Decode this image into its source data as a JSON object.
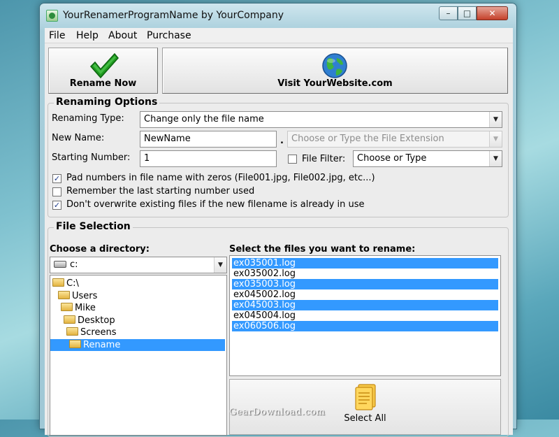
{
  "window": {
    "title": "YourRenamerProgramName by YourCompany",
    "controls": {
      "minimize": "–",
      "maximize": "□",
      "close": "✕"
    }
  },
  "menu": {
    "items": [
      "File",
      "Help",
      "About",
      "Purchase"
    ]
  },
  "toolbar": {
    "rename_now": "Rename Now",
    "visit_website": "Visit YourWebsite.com"
  },
  "renaming_options": {
    "title": "Renaming Options",
    "type_label": "Renaming Type:",
    "type_value": "Change only the file name",
    "new_name_label": "New Name:",
    "new_name_value": "NewName",
    "extension_placeholder": "Choose or Type the File Extension",
    "separator": ".",
    "starting_number_label": "Starting Number:",
    "starting_number_value": "1",
    "file_filter_label": "File Filter:",
    "file_filter_checked": false,
    "file_filter_value": "Choose or Type",
    "checkboxes": [
      {
        "label": "Pad numbers in file name with zeros (File001.jpg, File002.jpg, etc...)",
        "checked": true
      },
      {
        "label": "Remember the last starting number used",
        "checked": false
      },
      {
        "label": "Don't overwrite existing files if the new filename is already in use",
        "checked": true
      }
    ]
  },
  "file_selection": {
    "title": "File Selection",
    "directory_label": "Choose a directory:",
    "drive_value": "c:",
    "tree": [
      {
        "label": "C:\\",
        "depth": 0,
        "selected": false
      },
      {
        "label": "Users",
        "depth": 1,
        "selected": false
      },
      {
        "label": "Mike",
        "depth": 2,
        "selected": false
      },
      {
        "label": "Desktop",
        "depth": 3,
        "selected": false
      },
      {
        "label": "Screens",
        "depth": 4,
        "selected": false
      },
      {
        "label": "Rename",
        "depth": 5,
        "selected": true
      }
    ],
    "files_label": "Select the files you want to rename:",
    "files": [
      {
        "name": "ex035001.log",
        "selected": true
      },
      {
        "name": "ex035002.log",
        "selected": false
      },
      {
        "name": "ex035003.log",
        "selected": true
      },
      {
        "name": "ex045002.log",
        "selected": false
      },
      {
        "name": "ex045003.log",
        "selected": true
      },
      {
        "name": "ex045004.log",
        "selected": false
      },
      {
        "name": "ex060506.log",
        "selected": true
      }
    ],
    "select_all": "Select All"
  },
  "watermark": "GearDownload.com",
  "icons": {
    "rename": "checkmark-icon",
    "website": "globe-icon",
    "select_all": "document-stack-icon",
    "folder": "folder-icon",
    "drive": "drive-icon"
  },
  "colors": {
    "selection": "#3399ff",
    "checkmark": "#1f9a1f",
    "window_frame": "#a9cfdc",
    "desktop": "#7fc1cf"
  }
}
